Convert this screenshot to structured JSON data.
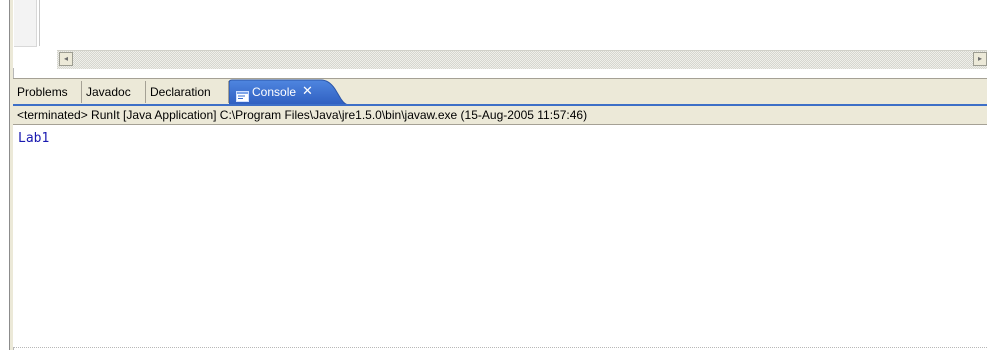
{
  "tabs": [
    {
      "label": "Problems"
    },
    {
      "label": "Javadoc"
    },
    {
      "label": "Declaration"
    },
    {
      "label": "Console",
      "active": true,
      "icon": "console-icon",
      "close": "✕"
    }
  ],
  "console": {
    "status": "<terminated> RunIt [Java Application] C:\\Program Files\\Java\\jre1.5.0\\bin\\javaw.exe (15-Aug-2005 11:57:46)",
    "output": "Lab1"
  },
  "scrollbar": {
    "left_arrow": "◂",
    "right_arrow": "▸"
  },
  "colors": {
    "active_tab": "#3a6fd0",
    "output_text": "#1a1ab0",
    "frame": "#ece9d8"
  }
}
